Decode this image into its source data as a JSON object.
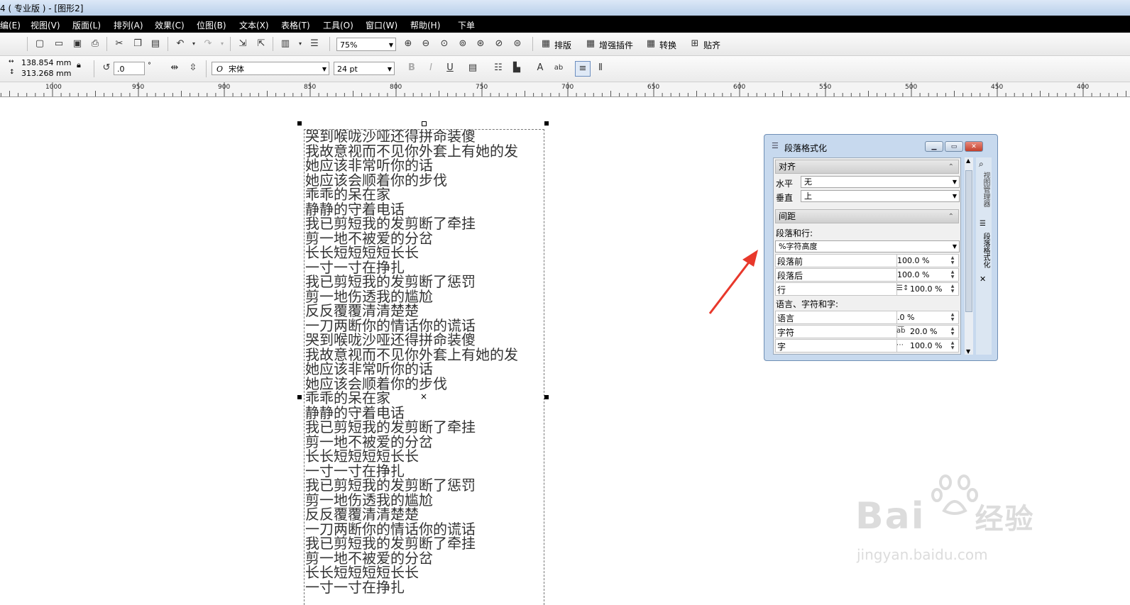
{
  "window": {
    "title": "4 ( 专业版 ) - [图形2]"
  },
  "menu": [
    {
      "label": "编(E)"
    },
    {
      "label": "视图(V)"
    },
    {
      "label": "版面(L)"
    },
    {
      "label": "排列(A)"
    },
    {
      "label": "效果(C)"
    },
    {
      "label": "位图(B)"
    },
    {
      "label": "文本(X)"
    },
    {
      "label": "表格(T)"
    },
    {
      "label": "工具(O)"
    },
    {
      "label": "窗口(W)"
    },
    {
      "label": "帮助(H)"
    },
    {
      "label": "下单"
    }
  ],
  "toolbar": {
    "zoom": "75%",
    "buttons": {
      "layout": "排版",
      "plugins": "增强插件",
      "convert": "转换",
      "paste": "贴齐"
    }
  },
  "propertybar": {
    "width": "138.854 mm",
    "height": "313.268 mm",
    "rotation": ".0",
    "rotation_unit": "°",
    "font": "宋体",
    "font_size": "24 pt"
  },
  "ruler": {
    "labels": [
      "1000",
      "950",
      "900",
      "850",
      "800",
      "750",
      "700",
      "650",
      "600",
      "550",
      "500",
      "450",
      "400"
    ]
  },
  "document": {
    "lines": [
      "哭到喉咙沙哑还得拼命装傻",
      "我故意视而不见你外套上有她的发",
      "她应该非常听你的话",
      "她应该会顺着你的步伐",
      "乖乖的呆在家",
      "静静的守着电话",
      "我已剪短我的发剪断了牵挂",
      "剪一地不被爱的分岔",
      "长长短短短短长长",
      "一寸一寸在挣扎",
      "我已剪短我的发剪断了惩罚",
      "剪一地伤透我的尴尬",
      "反反覆覆清清楚楚",
      "一刀两断你的情话你的谎话",
      "哭到喉咙沙哑还得拼命装傻",
      "我故意视而不见你外套上有她的发",
      "她应该非常听你的话",
      "她应该会顺着你的步伐",
      "乖乖的呆在家",
      "静静的守着电话",
      "我已剪短我的发剪断了牵挂",
      "剪一地不被爱的分岔",
      "长长短短短短长长",
      "一寸一寸在挣扎",
      "我已剪短我的发剪断了惩罚",
      "剪一地伤透我的尴尬",
      "反反覆覆清清楚楚",
      "一刀两断你的情话你的谎话",
      "我已剪短我的发剪断了牵挂",
      "剪一地不被爱的分岔",
      "长长短短短短长长",
      "一寸一寸在挣扎"
    ]
  },
  "panel": {
    "title": "段落格式化",
    "align": {
      "header": "对齐",
      "horizontal_label": "水平",
      "horizontal_value": "无",
      "vertical_label": "垂直",
      "vertical_value": "上"
    },
    "spacing": {
      "header": "间距",
      "para_line_label": "段落和行:",
      "unit": "%字符高度",
      "before_label": "段落前",
      "before_value": "100.0 %",
      "after_label": "段落后",
      "after_value": "100.0 %",
      "line_label": "行",
      "line_value": "100.0 %",
      "lang_header": "语言、字符和字:",
      "language_label": "语言",
      "language_value": ".0 %",
      "char_label": "字符",
      "char_value": "20.0 %",
      "word_label": "字",
      "word_value": "100.0 %"
    },
    "side_tabs": [
      "视图管理器",
      "段落格式化"
    ]
  },
  "watermark": {
    "brand": "Bai",
    "brand_suffix": "经验",
    "url": "jingyan.baidu.com"
  },
  "colors": {
    "menu_bg": "#000000",
    "arrow": "#e8382b",
    "panel_frame": "#c7d9ee"
  }
}
